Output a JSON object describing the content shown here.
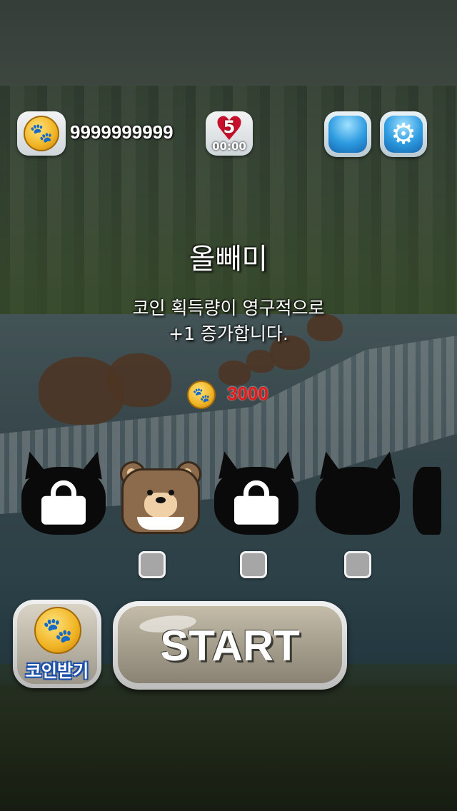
{
  "hud": {
    "coin_balance": "9999999999",
    "hearts_count": "5",
    "heart_timer": "00:00"
  },
  "character": {
    "name": "올빼미",
    "description": "코인 획득량이 영구적으로\n+1 증가합니다.",
    "price": "3000"
  },
  "buttons": {
    "collect_coins_label": "코인받기",
    "start_label": "START"
  },
  "icons": [
    "paw-coin-icon",
    "heart-icon",
    "gear-icon",
    "lock-icon"
  ],
  "colors": {
    "price_red": "#e21b1b",
    "heart_red": "#c8102e",
    "blue_button": "#2d9be0",
    "coin_gold": "#f0b323"
  }
}
